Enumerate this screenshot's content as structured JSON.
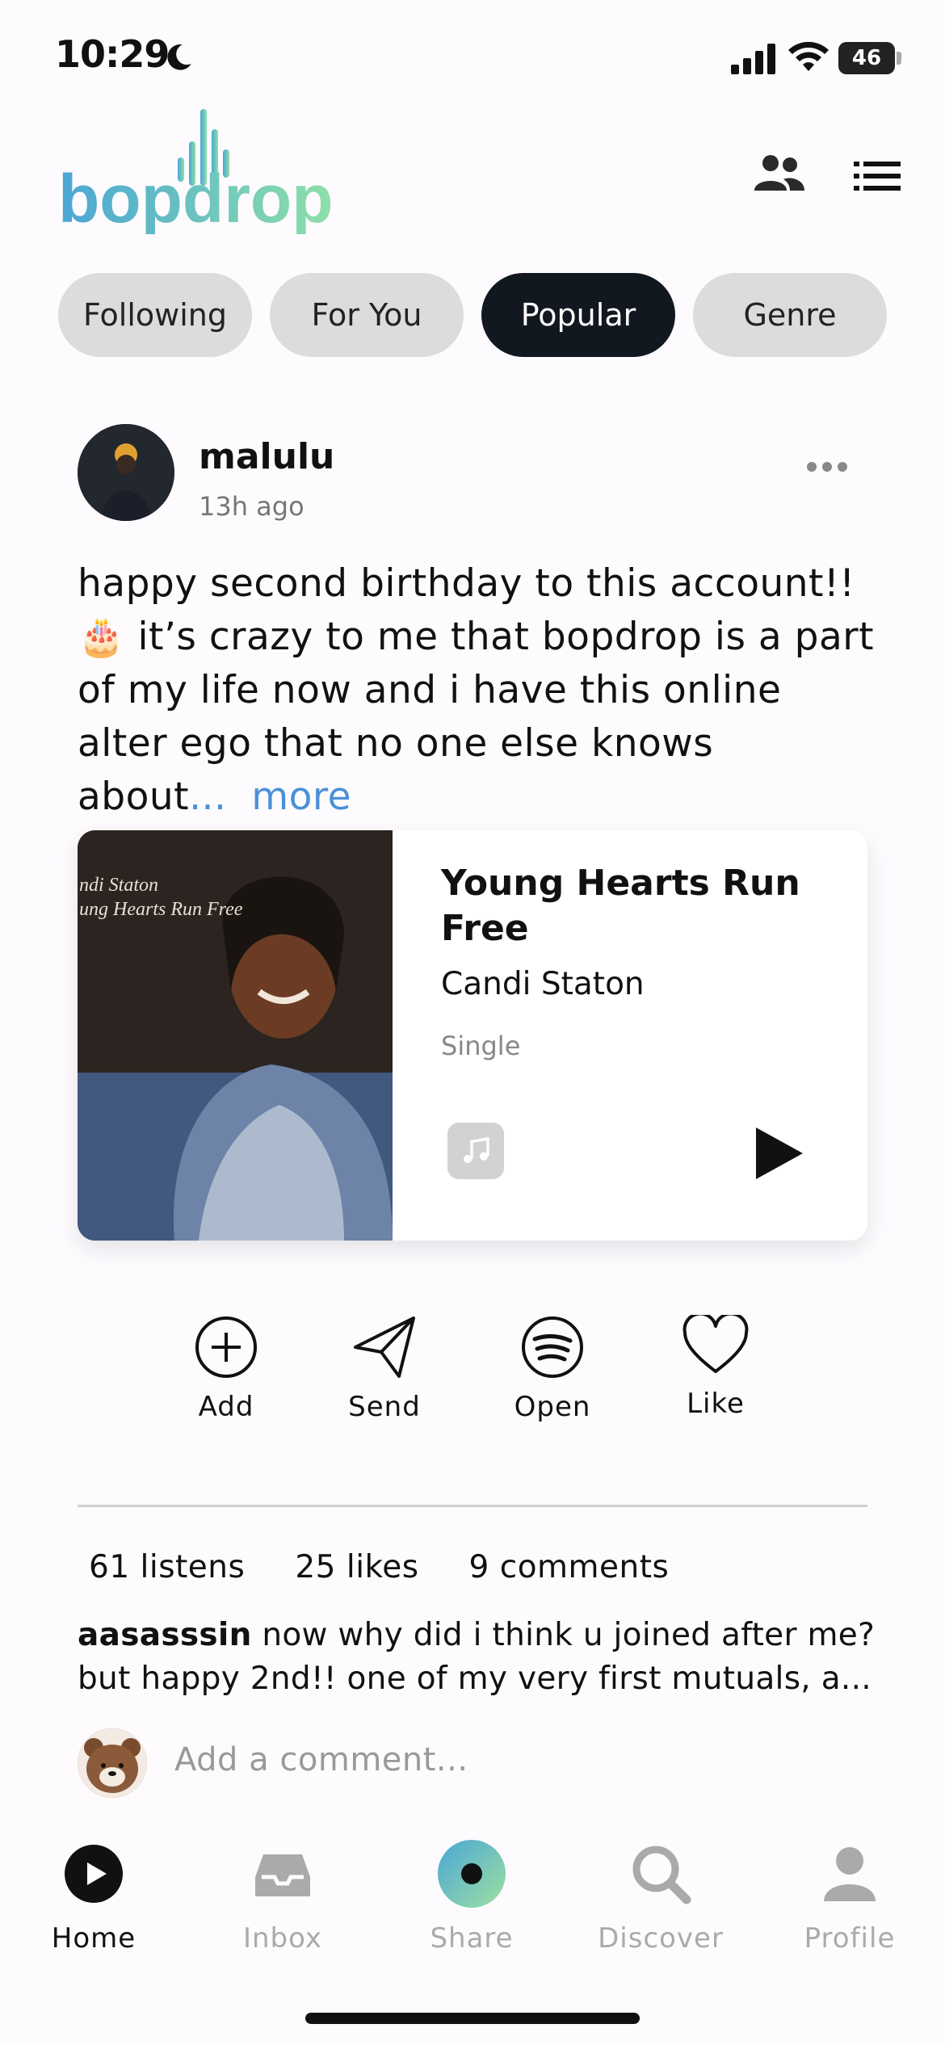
{
  "status": {
    "time": "10:29",
    "battery": "46"
  },
  "header": {
    "logo_text": "bopdrop"
  },
  "tabs": [
    {
      "label": "Following",
      "active": false
    },
    {
      "label": "For You",
      "active": false
    },
    {
      "label": "Popular",
      "active": true
    },
    {
      "label": "Genre",
      "active": false
    }
  ],
  "post": {
    "username": "malulu",
    "time_ago": "13h ago",
    "text": "happy second birthday to this account!! 🎂 it’s crazy to me that bopdrop is a part of my life now and i have this online alter ego that no one else knows about",
    "ellipsis": "...",
    "more_label": "more",
    "track": {
      "title": "Young Hearts Run Free",
      "artist": "Candi Staton",
      "type": "Single",
      "cover_text": "ndi Staton\nung Hearts Run Free"
    },
    "actions": {
      "add": "Add",
      "send": "Send",
      "open": "Open",
      "like": "Like"
    },
    "stats": {
      "listens": "61 listens",
      "likes": "25 likes",
      "comments": "9 comments"
    },
    "top_comment": {
      "user": "aasasssin",
      "text": "now why did i think u joined after me? but happy 2nd!! one of my very first mutuals, a..."
    },
    "add_comment_placeholder": "Add a comment..."
  },
  "nav": {
    "home": "Home",
    "inbox": "Inbox",
    "share": "Share",
    "discover": "Discover",
    "profile": "Profile"
  },
  "colors": {
    "accent": "#4a90d9",
    "active_tab": "#121820",
    "logo_gradient": [
      "#4aa6d6",
      "#7fd6a6"
    ]
  }
}
